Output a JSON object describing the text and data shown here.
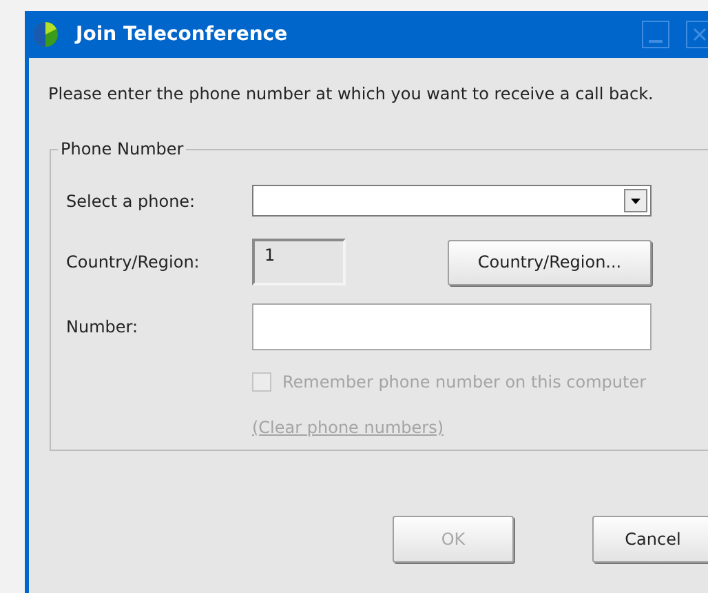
{
  "window": {
    "title": "Join Teleconference"
  },
  "instruction": "Please enter the phone number at which you want to receive a call back.",
  "group": {
    "legend": "Phone Number",
    "fields": [
      {
        "kind": "select",
        "label": "Select a phone:"
      },
      {
        "kind": "readonly",
        "label": "Country/Region:",
        "value": "1",
        "button": "Country/Region..."
      },
      {
        "kind": "text",
        "label": "Number:"
      }
    ],
    "remember": {
      "label": "Remember phone number on this computer",
      "checked": false,
      "disabled": true
    },
    "clear_link": {
      "label": "(Clear phone numbers)",
      "disabled": true
    }
  },
  "buttons": [
    {
      "label": "OK",
      "disabled": true
    },
    {
      "label": "Cancel",
      "disabled": false
    }
  ]
}
